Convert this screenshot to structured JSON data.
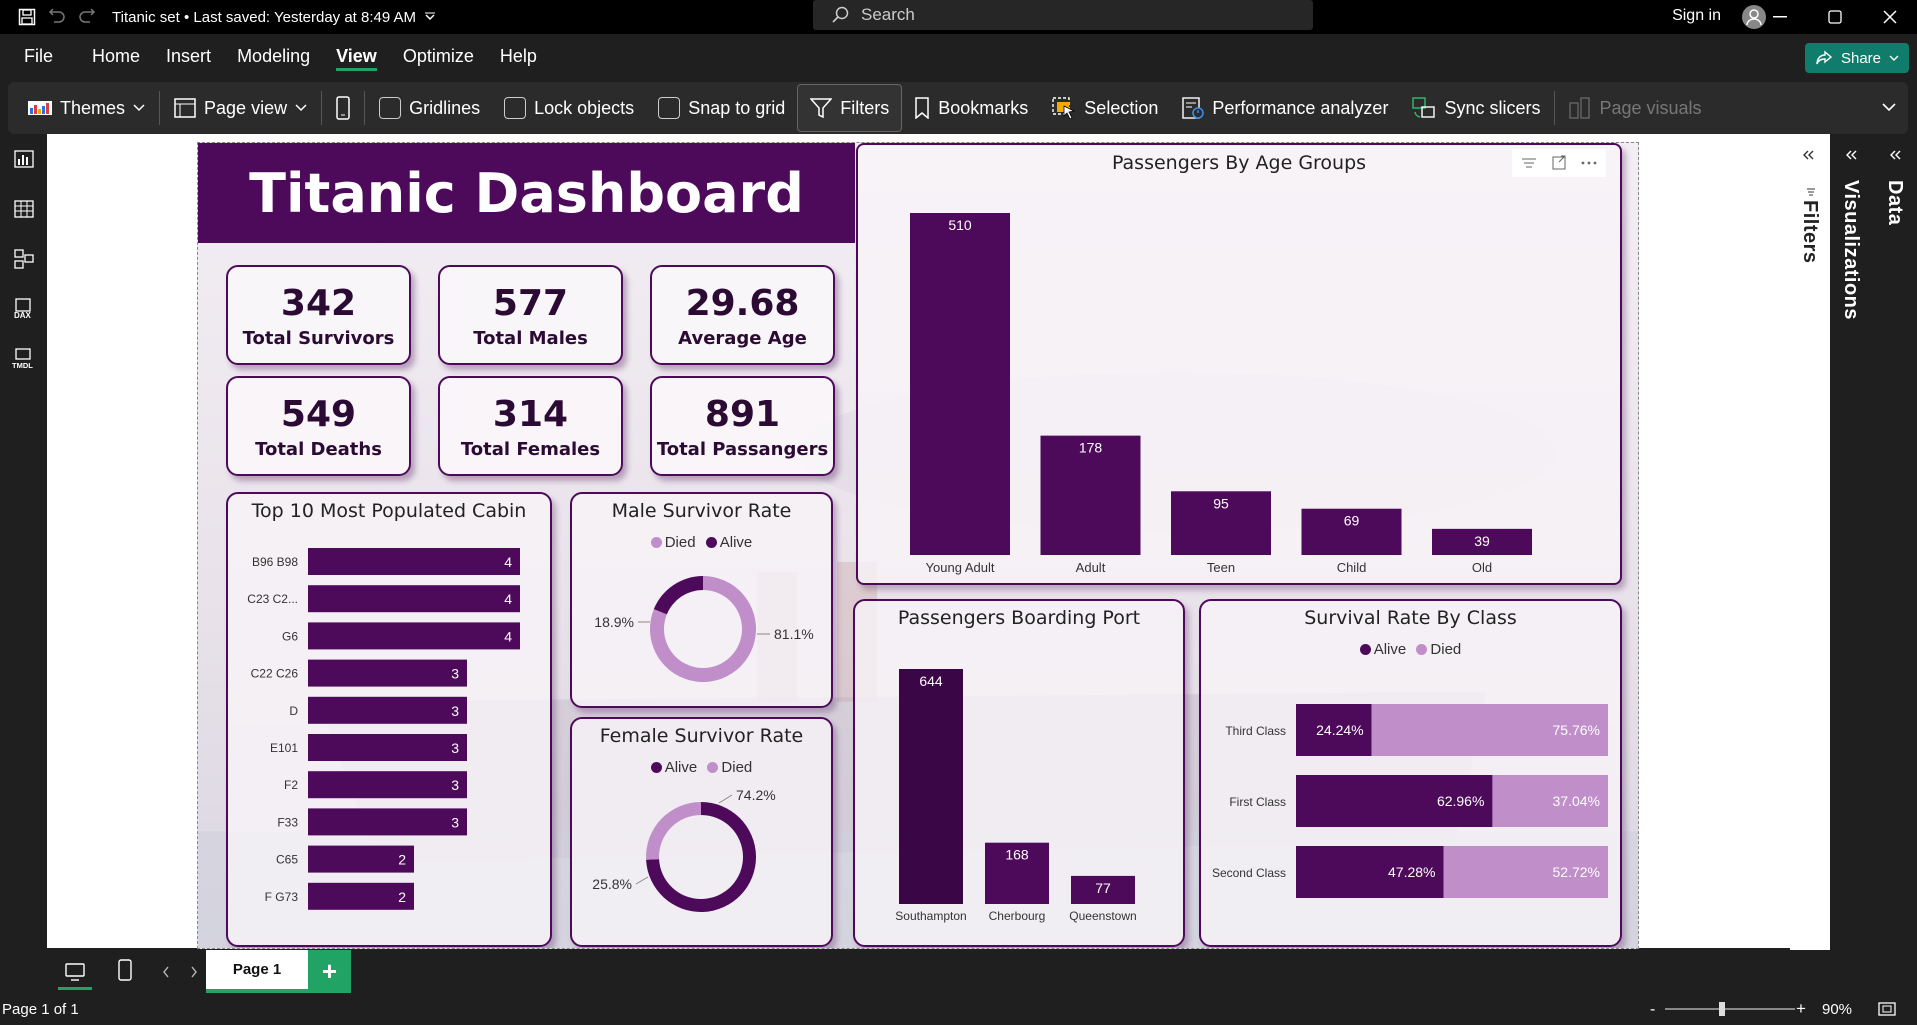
{
  "titlebar": {
    "title": "Titanic set • Last saved: Yesterday at 8:49 AM",
    "search_placeholder": "Search",
    "signin": "Sign in"
  },
  "menu": [
    "File",
    "Home",
    "Insert",
    "Modeling",
    "View",
    "Optimize",
    "Help"
  ],
  "menu_active": "View",
  "share": "Share",
  "ribbon": {
    "themes": "Themes",
    "page_view": "Page view",
    "gridlines": "Gridlines",
    "lock_objects": "Lock objects",
    "snap_to_grid": "Snap to grid",
    "filters": "Filters",
    "bookmarks": "Bookmarks",
    "selection": "Selection",
    "performance_analyzer": "Performance analyzer",
    "sync_slicers": "Sync slicers",
    "page_visuals": "Page visuals"
  },
  "panes": {
    "filters": "Filters",
    "visualizations": "Visualizations",
    "data": "Data"
  },
  "pages": {
    "tab": "Page 1",
    "status": "Page 1 of 1",
    "zoom": "90%"
  },
  "report": {
    "title": "Titanic Dashboard",
    "kpis": [
      {
        "value": "342",
        "label": "Total Survivors"
      },
      {
        "value": "577",
        "label": "Total Males"
      },
      {
        "value": "29.68",
        "label": "Average Age"
      },
      {
        "value": "549",
        "label": "Total Deaths"
      },
      {
        "value": "314",
        "label": "Total Females"
      },
      {
        "value": "891",
        "label": "Total Passangers"
      }
    ],
    "colors": {
      "dark": "#4d0a5a",
      "darker": "#3a0645",
      "light": "#c08ec9"
    }
  },
  "chart_data": [
    {
      "id": "age",
      "type": "bar",
      "title": "Passengers By Age Groups",
      "categories": [
        "Young Adult",
        "Adult",
        "Teen",
        "Child",
        "Old"
      ],
      "values": [
        510,
        178,
        95,
        69,
        39
      ]
    },
    {
      "id": "cabin",
      "type": "bar",
      "orientation": "horizontal",
      "title": "Top 10 Most Populated Cabin",
      "categories": [
        "B96 B98",
        "C23 C2...",
        "G6",
        "C22 C26",
        "D",
        "E101",
        "F2",
        "F33",
        "C65",
        "F G73"
      ],
      "values": [
        4,
        4,
        4,
        3,
        3,
        3,
        3,
        3,
        2,
        2
      ]
    },
    {
      "id": "male",
      "type": "pie",
      "title": "Male Survivor Rate",
      "legend": [
        "Died",
        "Alive"
      ],
      "slices": [
        {
          "name": "Died",
          "value": 81.1,
          "label": "81.1%"
        },
        {
          "name": "Alive",
          "value": 18.9,
          "label": "18.9%"
        }
      ]
    },
    {
      "id": "female",
      "type": "pie",
      "title": "Female Survivor Rate",
      "legend": [
        "Alive",
        "Died"
      ],
      "slices": [
        {
          "name": "Alive",
          "value": 74.2,
          "label": "74.2%"
        },
        {
          "name": "Died",
          "value": 25.8,
          "label": "25.8%"
        }
      ]
    },
    {
      "id": "port",
      "type": "bar",
      "title": "Passengers Boarding Port",
      "categories": [
        "Southampton",
        "Cherbourg",
        "Queenstown"
      ],
      "values": [
        644,
        168,
        77
      ]
    },
    {
      "id": "class",
      "type": "bar",
      "orientation": "horizontal",
      "stacked": "100%",
      "title": "Survival Rate By Class",
      "legend": [
        "Alive",
        "Died"
      ],
      "categories": [
        "Third Class",
        "First Class",
        "Second Class"
      ],
      "series": [
        {
          "name": "Alive",
          "values": [
            24.24,
            62.96,
            47.28
          ],
          "labels": [
            "24.24%",
            "62.96%",
            "47.28%"
          ]
        },
        {
          "name": "Died",
          "values": [
            75.76,
            37.04,
            52.72
          ],
          "labels": [
            "75.76%",
            "37.04%",
            "52.72%"
          ]
        }
      ]
    }
  ]
}
